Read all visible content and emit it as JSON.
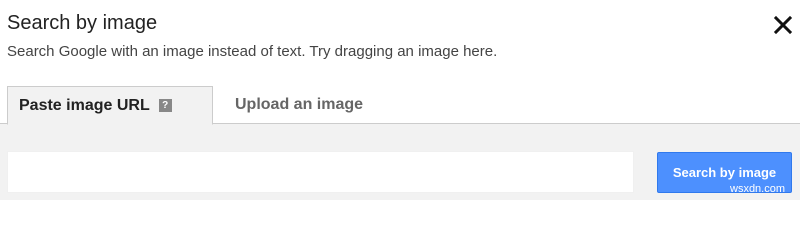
{
  "dialog": {
    "title": "Search by image",
    "subtitle": "Search Google with an image instead of text. Try dragging an image here.",
    "close_icon": "close-icon"
  },
  "tabs": [
    {
      "label": "Paste image URL",
      "active": true,
      "icon": "help-icon"
    },
    {
      "label": "Upload an image",
      "active": false
    }
  ],
  "paste_panel": {
    "url_value": "",
    "search_button_label": "Search by image"
  },
  "colors": {
    "button_blue": "#4d90fe",
    "panel_gray": "#f2f2f2",
    "tab_border": "#cccccc"
  },
  "watermark": "wsxdn.com"
}
